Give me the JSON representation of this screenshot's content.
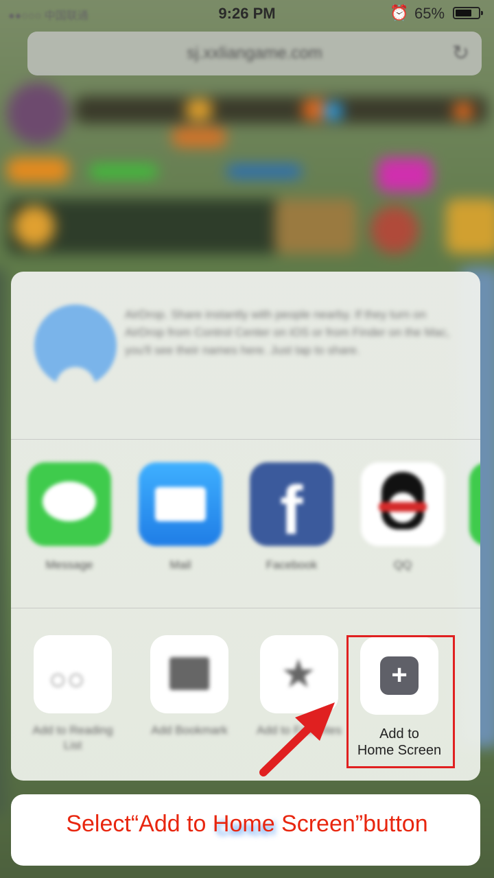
{
  "status_bar": {
    "carrier": "●●○○○ 中国联通",
    "time": "9:26 PM",
    "alarm_icon": "alarm-icon",
    "battery_percent": "65%",
    "battery_level": 0.65
  },
  "browser": {
    "url": "sj.xxliangame.com",
    "reload_icon": "reload-icon"
  },
  "share_sheet": {
    "airdrop": {
      "icon": "airdrop-icon",
      "text": "AirDrop. Share instantly with people nearby. If they turn on AirDrop from Control Center on iOS or from Finder on the Mac, you'll see their names here. Just tap to share."
    },
    "apps": [
      {
        "label": "Message",
        "icon": "message-icon",
        "color": "#3fcb4c"
      },
      {
        "label": "Mail",
        "icon": "mail-icon",
        "color": "#2d8ff2"
      },
      {
        "label": "Facebook",
        "icon": "facebook-icon",
        "color": "#3b5a9c"
      },
      {
        "label": "QQ",
        "icon": "qq-penguin-icon",
        "color": "#ffffff"
      }
    ],
    "actions": [
      {
        "label": "Add to Reading List",
        "icon": "reading-list-icon"
      },
      {
        "label": "Add Bookmark",
        "icon": "bookmark-book-icon"
      },
      {
        "label": "Add to Favorites",
        "icon": "star-icon"
      }
    ],
    "add_home": {
      "label_line1": "Add to",
      "label_line2": "Home Screen",
      "icon": "plus-icon"
    }
  },
  "cancel_label": "Cancel",
  "annotation": {
    "caption": "Select“Add to Home Screen”button",
    "highlight_color": "#e02020"
  }
}
